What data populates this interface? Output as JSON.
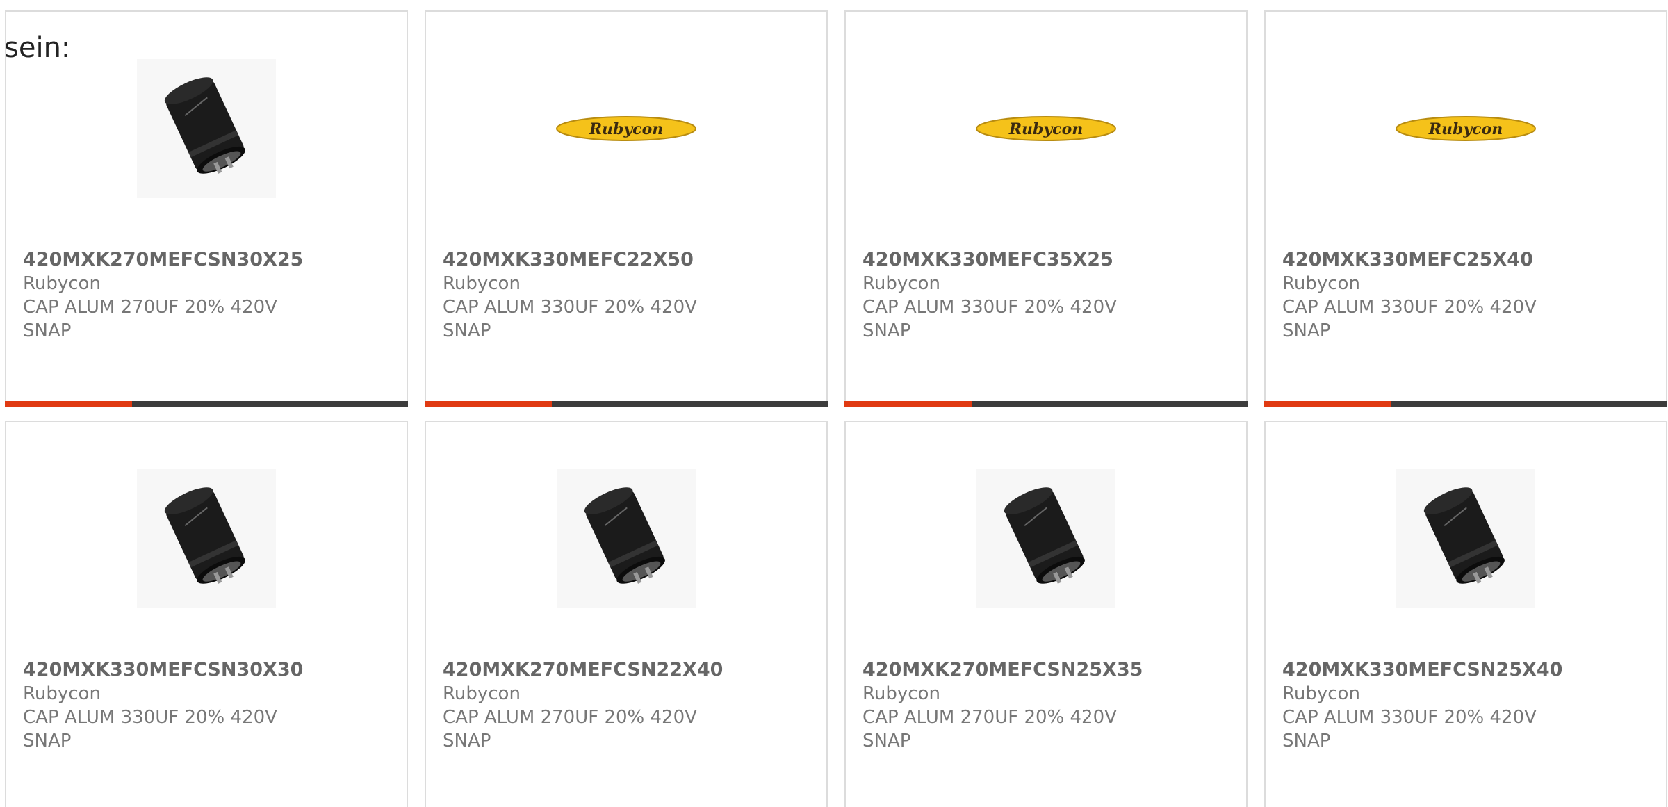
{
  "intro_text": "sein:",
  "colors": {
    "accent": "#e03a12",
    "bar": "#3c3c3c",
    "logo_yellow": "#f5c21a"
  },
  "products": [
    {
      "part_number": "420MXK270MEFCSN30X25",
      "manufacturer": "Rubycon",
      "desc_line1": "CAP ALUM 270UF 20% 420V",
      "desc_line2": "SNAP",
      "image": "capacitor-photo"
    },
    {
      "part_number": "420MXK330MEFC22X50",
      "manufacturer": "Rubycon",
      "desc_line1": "CAP ALUM 330UF 20% 420V",
      "desc_line2": "SNAP",
      "image": "rubycon-logo",
      "logo_text": "Rubycon"
    },
    {
      "part_number": "420MXK330MEFC35X25",
      "manufacturer": "Rubycon",
      "desc_line1": "CAP ALUM 330UF 20% 420V",
      "desc_line2": "SNAP",
      "image": "rubycon-logo",
      "logo_text": "Rubycon"
    },
    {
      "part_number": "420MXK330MEFC25X40",
      "manufacturer": "Rubycon",
      "desc_line1": "CAP ALUM 330UF 20% 420V",
      "desc_line2": "SNAP",
      "image": "rubycon-logo",
      "logo_text": "Rubycon"
    },
    {
      "part_number": "420MXK330MEFCSN30X30",
      "manufacturer": "Rubycon",
      "desc_line1": "CAP ALUM 330UF 20% 420V",
      "desc_line2": "SNAP",
      "image": "capacitor-photo"
    },
    {
      "part_number": "420MXK270MEFCSN22X40",
      "manufacturer": "Rubycon",
      "desc_line1": "CAP ALUM 270UF 20% 420V",
      "desc_line2": "SNAP",
      "image": "capacitor-photo"
    },
    {
      "part_number": "420MXK270MEFCSN25X35",
      "manufacturer": "Rubycon",
      "desc_line1": "CAP ALUM 270UF 20% 420V",
      "desc_line2": "SNAP",
      "image": "capacitor-photo"
    },
    {
      "part_number": "420MXK330MEFCSN25X40",
      "manufacturer": "Rubycon",
      "desc_line1": "CAP ALUM 330UF 20% 420V",
      "desc_line2": "SNAP",
      "image": "capacitor-photo"
    }
  ]
}
